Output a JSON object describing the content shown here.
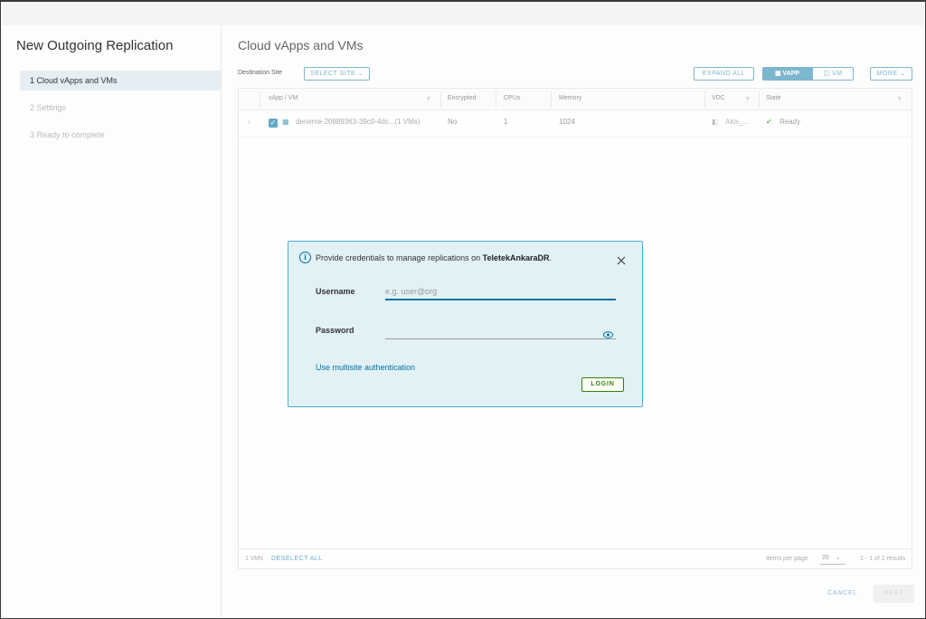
{
  "wizard": {
    "title": "New Outgoing Replication",
    "steps": [
      {
        "label": "1  Cloud vApps and VMs"
      },
      {
        "label": "2  Settings"
      },
      {
        "label": "3  Ready to complete"
      }
    ]
  },
  "content": {
    "title": "Cloud vApps and VMs",
    "destination_label": "Destination Site",
    "select_site_label": "SELECT SITE",
    "expand_all_label": "EXPAND ALL",
    "vapp_toggle_label": "VAPP",
    "vm_toggle_label": "VM",
    "more_label": "MORE"
  },
  "grid": {
    "columns": [
      "vApp / VM",
      "Encrypted",
      "CPUs",
      "Memory",
      "VDC",
      "State"
    ],
    "rows": [
      {
        "name": "deneme-20889363-39c0-4dc...(1 VMs)",
        "encrypted": "No",
        "cpus": "1",
        "memory": "1024",
        "vdc": "Akis_...",
        "state": "Ready"
      }
    ],
    "footer": {
      "selected_count": "1 VMs",
      "deselect_all": "DESELECT ALL",
      "items_per_page_label": "Items per page",
      "items_per_page_value": "20",
      "results": "1 - 1 of 1 results"
    }
  },
  "actions": {
    "cancel_label": "CANCEL",
    "next_label": "NEXT"
  },
  "dialog": {
    "message_prefix": "Provide credentials to manage replications on ",
    "site_name": "TeletekAnkaraDR",
    "message_suffix": ".",
    "username_label": "Username",
    "username_placeholder": "e.g. user@org",
    "username_value": "",
    "password_label": "Password",
    "password_value": "",
    "multisite_link": "Use multisite authentication",
    "login_label": "LOGIN"
  },
  "colors": {
    "accent": "#0072a3",
    "dialog_bg": "#e1f1f6",
    "dialog_border": "#49afd9",
    "login_green": "#2f8400"
  }
}
